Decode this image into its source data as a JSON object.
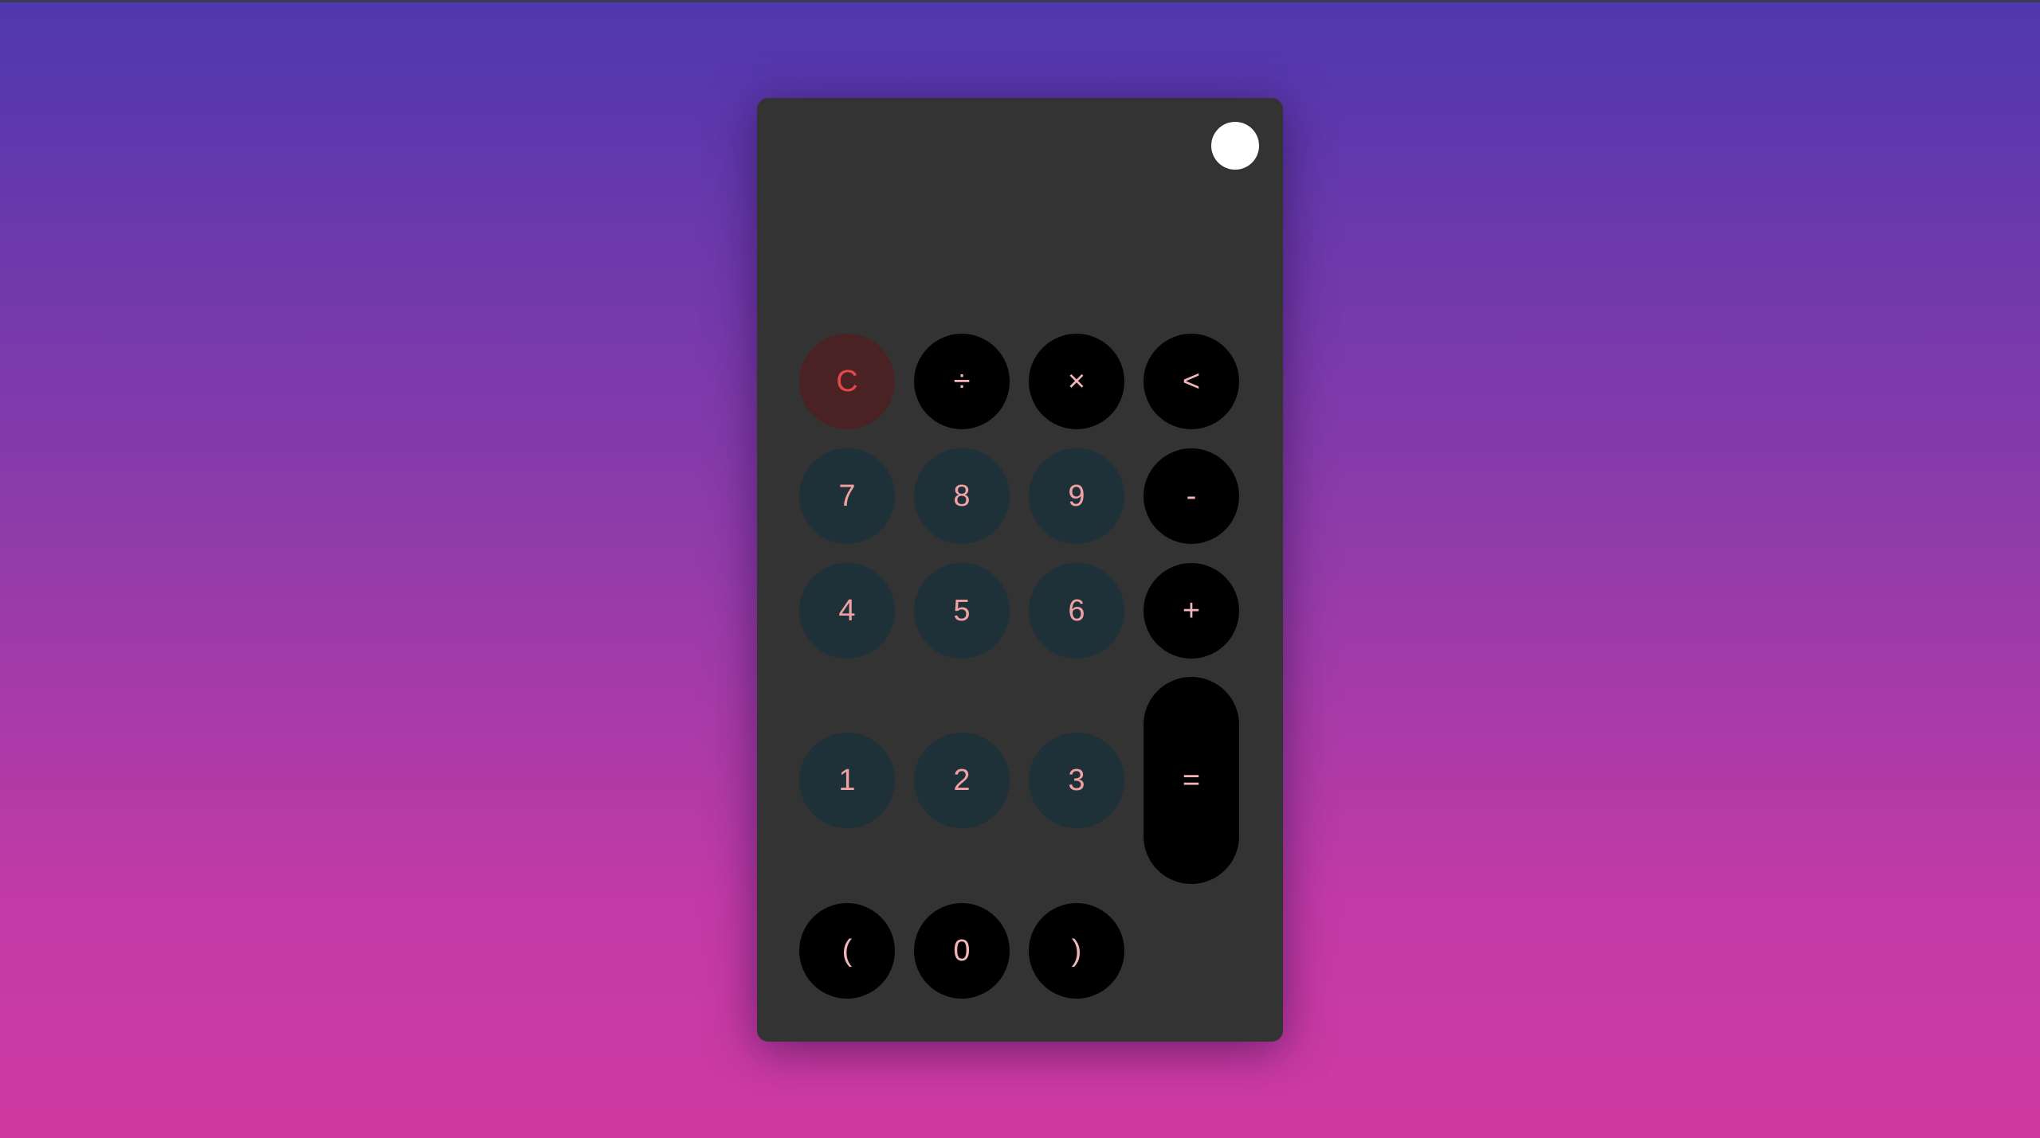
{
  "display": {
    "value": ""
  },
  "theme_toggle": {
    "color": "#ffffff"
  },
  "keys": {
    "clear": "C",
    "divide": "÷",
    "multiply": "×",
    "backspace": "<",
    "seven": "7",
    "eight": "8",
    "nine": "9",
    "minus": "-",
    "four": "4",
    "five": "5",
    "six": "6",
    "plus": "+",
    "one": "1",
    "two": "2",
    "three": "3",
    "equals": "=",
    "open_paren": "(",
    "zero": "0",
    "close_paren": ")"
  },
  "colors": {
    "background_top": "#4f37ae",
    "background_bottom": "#cf3aa2",
    "calculator_body": "#333333",
    "number_key": "#1e3038",
    "operator_key": "#000000",
    "clear_key": "#4a2224",
    "clear_text": "#e54848",
    "key_text": "#f0a1a3"
  }
}
